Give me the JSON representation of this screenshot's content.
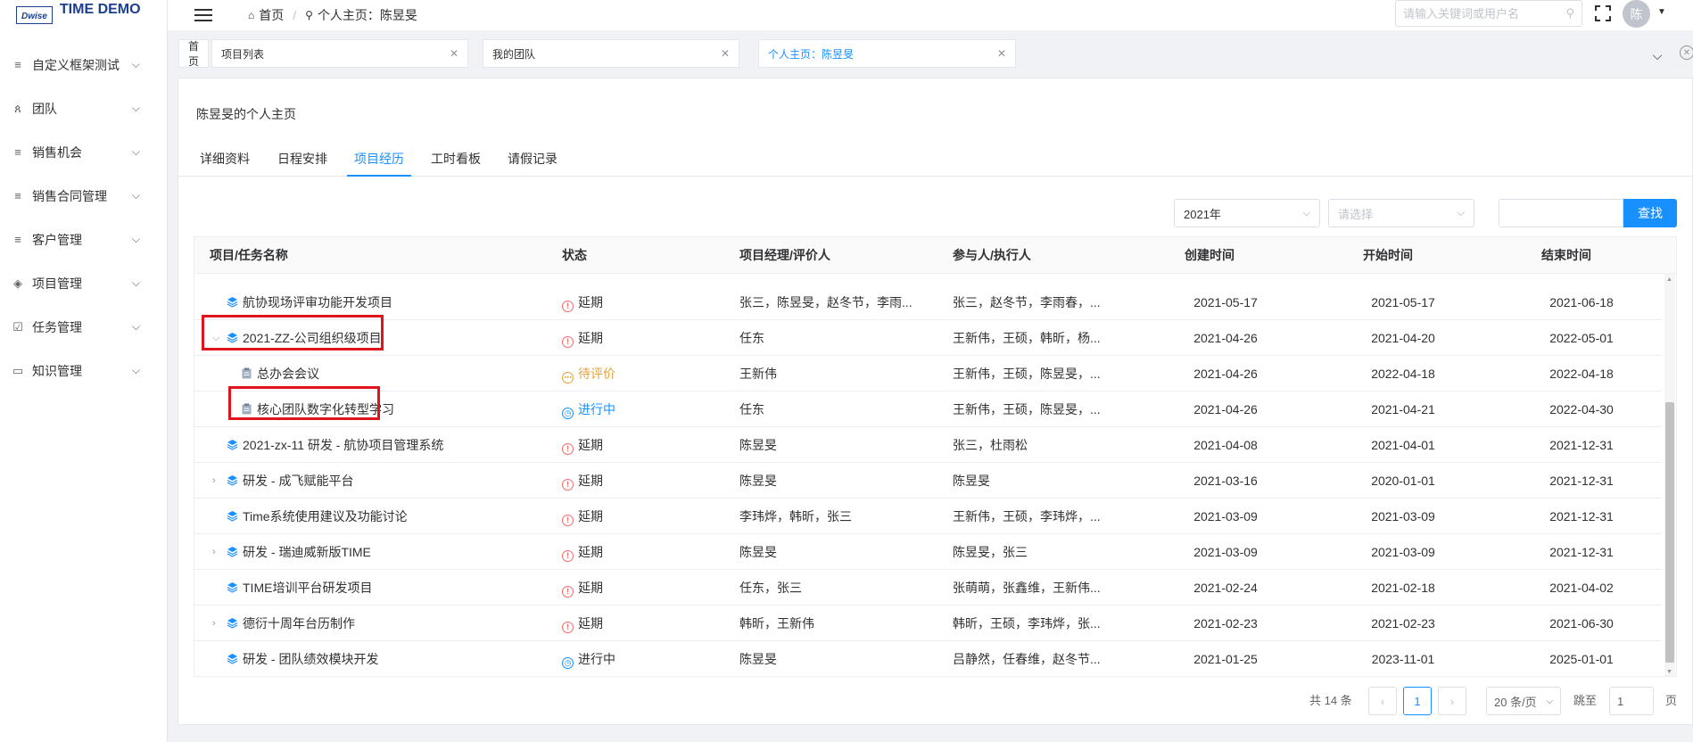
{
  "app": {
    "logo_badge": "Dwise",
    "title": "TIME DEMO"
  },
  "sidebar": {
    "items": [
      {
        "label": "自定义框架测试",
        "icon": "list-icon"
      },
      {
        "label": "团队",
        "icon": "team-icon"
      },
      {
        "label": "销售机会",
        "icon": "list-icon"
      },
      {
        "label": "销售合同管理",
        "icon": "list-icon"
      },
      {
        "label": "客户管理",
        "icon": "list-icon"
      },
      {
        "label": "项目管理",
        "icon": "layers-icon"
      },
      {
        "label": "任务管理",
        "icon": "checkbox-icon"
      },
      {
        "label": "知识管理",
        "icon": "book-icon"
      }
    ]
  },
  "header": {
    "breadcrumb_home": "首页",
    "breadcrumb_current": "个人主页：陈昱旻",
    "search_placeholder": "请输入关键词或用户名",
    "avatar_text": "陈"
  },
  "page_tabs": [
    {
      "label": "首页",
      "closable": false
    },
    {
      "label": "项目列表",
      "closable": true
    },
    {
      "label": "我的团队",
      "closable": true
    },
    {
      "label": "个人主页：陈昱旻",
      "closable": true,
      "active": true
    }
  ],
  "card": {
    "title": "陈昱旻的个人主页",
    "tabs": [
      "详细资料",
      "日程安排",
      "项目经历",
      "工时看板",
      "请假记录"
    ],
    "active_tab": "项目经历"
  },
  "filters": {
    "year_value": "2021年",
    "status_placeholder": "请选择",
    "keyword_value": "",
    "find_label": "查找"
  },
  "table": {
    "headers": [
      "项目/任务名称",
      "状态",
      "项目经理/评价人",
      "参与人/执行人",
      "创建时间",
      "开始时间",
      "结束时间"
    ],
    "rows": [
      {
        "name": "航协现场评审功能开发项目",
        "status": "延期",
        "manager": "张三，陈昱旻，赵冬节，李雨...",
        "members": "张三，赵冬节，李雨春，...",
        "created": "2021-05-17",
        "start": "2021-05-17",
        "end": "2021-06-18"
      },
      {
        "name": "2021-ZZ-公司组织级项目",
        "status": "延期",
        "manager": "任东",
        "members": "王新伟，王硕，韩昕，杨...",
        "created": "2021-04-26",
        "start": "2021-04-20",
        "end": "2022-05-01"
      },
      {
        "name": "总办会会议",
        "status": "待评价",
        "manager": "王新伟",
        "members": "王新伟，王硕，陈昱旻，...",
        "created": "2021-04-26",
        "start": "2022-04-18",
        "end": "2022-04-18"
      },
      {
        "name": "核心团队数字化转型学习",
        "status": "进行中",
        "manager": "任东",
        "members": "王新伟，王硕，陈昱旻，...",
        "created": "2021-04-26",
        "start": "2021-04-21",
        "end": "2022-04-30"
      },
      {
        "name": "2021-zx-11 研发 - 航协项目管理系统",
        "status": "延期",
        "manager": "陈昱旻",
        "members": "张三，杜雨松",
        "created": "2021-04-08",
        "start": "2021-04-01",
        "end": "2021-12-31"
      },
      {
        "name": "研发 - 成飞赋能平台",
        "status": "延期",
        "manager": "陈昱旻",
        "members": "陈昱旻",
        "created": "2021-03-16",
        "start": "2020-01-01",
        "end": "2021-12-31"
      },
      {
        "name": "Time系统使用建议及功能讨论",
        "status": "延期",
        "manager": "李玮烨，韩昕，张三",
        "members": "王新伟，王硕，李玮烨，...",
        "created": "2021-03-09",
        "start": "2021-03-09",
        "end": "2021-12-31"
      },
      {
        "name": "研发 - 瑞迪威新版TIME",
        "status": "延期",
        "manager": "陈昱旻",
        "members": "陈昱旻，张三",
        "created": "2021-03-09",
        "start": "2021-03-09",
        "end": "2021-12-31"
      },
      {
        "name": "TIME培训平台研发项目",
        "status": "延期",
        "manager": "任东，张三",
        "members": "张萌萌，张鑫维，王新伟...",
        "created": "2021-02-24",
        "start": "2021-02-18",
        "end": "2021-04-02"
      },
      {
        "name": "德衍十周年台历制作",
        "status": "延期",
        "manager": "韩昕，王新伟",
        "members": "韩昕，王硕，李玮烨，张...",
        "created": "2021-02-23",
        "start": "2021-02-23",
        "end": "2021-06-30"
      },
      {
        "name": "研发 - 团队绩效模块开发",
        "status": "进行中",
        "manager": "陈昱旻",
        "members": "吕静然，任春维，赵冬节...",
        "created": "2021-01-25",
        "start": "2023-11-01",
        "end": "2025-01-01"
      }
    ]
  },
  "pagination": {
    "total": "共 14 条",
    "current_page": "1",
    "page_size": "20 条/页",
    "jump_label": "跳至",
    "jump_value": "1",
    "page_suffix": "页"
  },
  "colors": {
    "primary": "#1890ff",
    "delay": "#f56c6c",
    "pending": "#e6a23c",
    "highlight_box": "#e0141c"
  }
}
